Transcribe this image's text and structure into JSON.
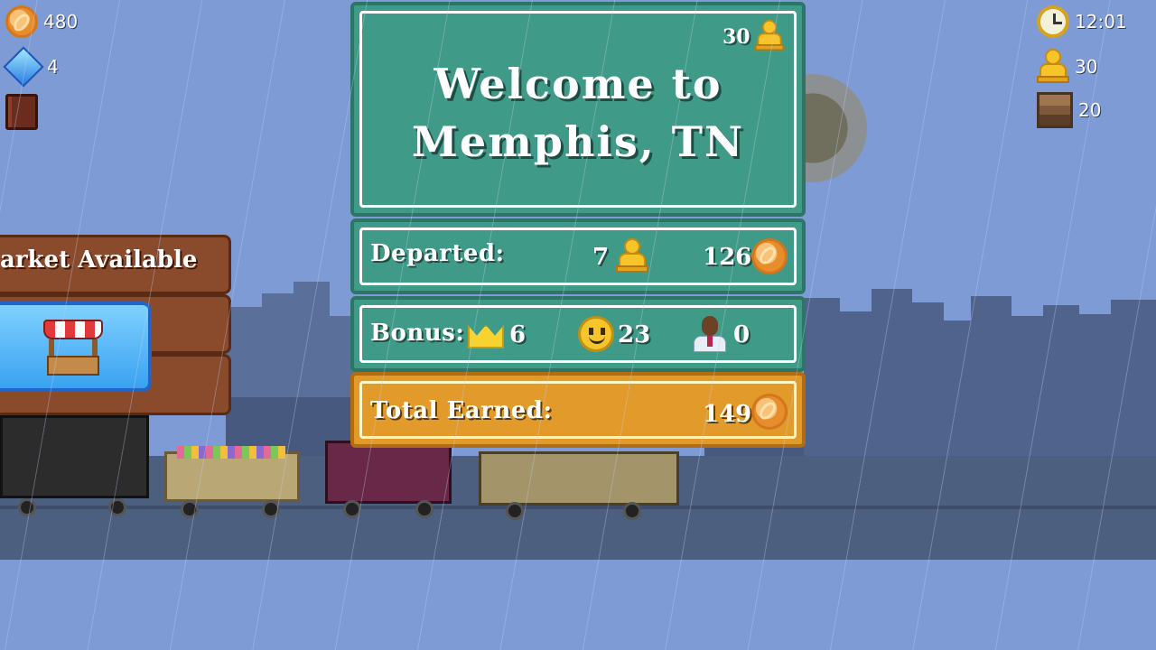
{
  "hud_left": {
    "coins": "480",
    "gems": "4",
    "coin_icon": "coin-icon",
    "gem_icon": "gem-icon",
    "book_icon": "book-icon"
  },
  "hud_right": {
    "time": "12:01",
    "passengers": "30",
    "cargo": "20",
    "clock_icon": "clock-icon",
    "passenger_icon": "passenger-icon",
    "cargo_icon": "crate-icon"
  },
  "welcome": {
    "capacity": "30",
    "line1": "Welcome to",
    "line2": "Memphis, TN"
  },
  "departed": {
    "label": "Departed:",
    "passengers": "7",
    "coins": "126"
  },
  "bonus": {
    "label": "Bonus:",
    "crown": "6",
    "smile": "23",
    "person": "0"
  },
  "total": {
    "label": "Total Earned:",
    "coins": "149"
  },
  "market": {
    "title": "arket Available"
  },
  "colors": {
    "sky": "#7f9bd6",
    "panel_green": "#3f9a87",
    "panel_orange": "#e29a2a",
    "market_brown": "#8a4a2c",
    "market_button_blue": "#3aa2f0"
  }
}
